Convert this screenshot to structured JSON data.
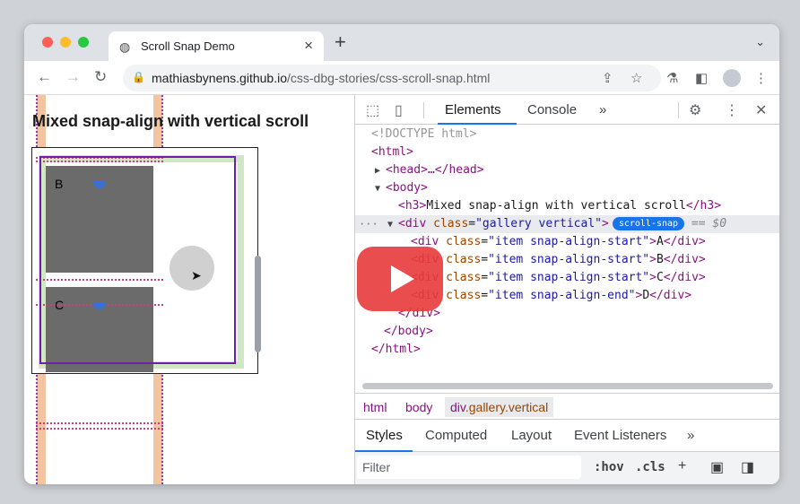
{
  "browser": {
    "tab_title": "Scroll Snap Demo",
    "url_host": "mathiasbynens.github.io",
    "url_path": "/css-dbg-stories/css-scroll-snap.html",
    "icons": [
      "back-icon",
      "forward-icon",
      "reload-icon",
      "lock-icon",
      "share-icon",
      "star-icon",
      "flask-icon",
      "sidepanel-icon",
      "profile-icon",
      "menu-icon"
    ]
  },
  "page": {
    "heading": "Mixed snap-align with vertical scroll",
    "items": [
      {
        "label": "B"
      },
      {
        "label": "C"
      }
    ]
  },
  "devtools": {
    "tabs": [
      "Elements",
      "Console"
    ],
    "more": "»",
    "tree": {
      "doctype": "<!DOCTYPE html>",
      "html_open": "<html>",
      "head": "<head>…</head>",
      "body_open": "<body>",
      "h3_open": "<h3>",
      "h3_text": "Mixed snap-align with vertical scroll",
      "h3_close": "</h3>",
      "div_open": "<div ",
      "class_attr": "class",
      "eq": "=",
      "gallery_val": "\"gallery vertical\"",
      "gt": ">",
      "badge": "scroll-snap",
      "dollar": "== $0",
      "ellipsis": "···",
      "children": [
        {
          "val": "\"item snap-align-start\"",
          "text": "A"
        },
        {
          "val": "\"item snap-align-start\"",
          "text": "B"
        },
        {
          "val": "\"item snap-align-start\"",
          "text": "C"
        },
        {
          "val": "\"item snap-align-end\"",
          "text": "D"
        }
      ],
      "div_close": "</div>",
      "body_close": "</body>",
      "html_close": "</html>"
    },
    "breadcrumbs": [
      "html",
      "body"
    ],
    "crumb_active_tag": "div",
    "crumb_active_class": ".gallery.vertical",
    "panel_tabs": [
      "Styles",
      "Computed",
      "Layout",
      "Event Listeners",
      "»"
    ],
    "filter_placeholder": "Filter",
    "hov": ":hov",
    "cls": ".cls",
    "plus": "+"
  },
  "colors": {
    "accent": "#1a73e8",
    "play": "#e83a3a",
    "snap_outline": "#6f1ea8"
  }
}
